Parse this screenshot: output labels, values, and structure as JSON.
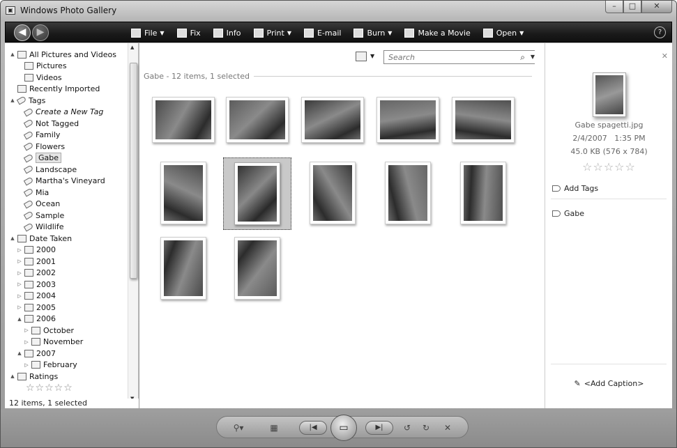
{
  "window": {
    "title": "Windows Photo Gallery"
  },
  "toolbar": {
    "items": [
      {
        "label": "File",
        "mnemonic": "F",
        "has_menu": true,
        "icon": "file-icon"
      },
      {
        "label": "Fix",
        "mnemonic": "x",
        "has_menu": false,
        "icon": "fix-icon"
      },
      {
        "label": "Info",
        "mnemonic": "I",
        "has_menu": false,
        "icon": "info-icon"
      },
      {
        "label": "Print",
        "mnemonic": "P",
        "has_menu": true,
        "icon": "print-icon"
      },
      {
        "label": "E-mail",
        "mnemonic": "E",
        "has_menu": false,
        "icon": "email-icon"
      },
      {
        "label": "Burn",
        "mnemonic": "u",
        "has_menu": true,
        "icon": "burn-icon"
      },
      {
        "label": "Make a Movie",
        "mnemonic": "k",
        "has_menu": false,
        "icon": "movie-icon"
      },
      {
        "label": "Open",
        "mnemonic": "O",
        "has_menu": true,
        "icon": "open-icon"
      }
    ],
    "help": "?"
  },
  "nav": {
    "items": [
      {
        "label": "All Pictures and Videos",
        "level": 0,
        "expander": "▲",
        "icon": "gallery-icon"
      },
      {
        "label": "Pictures",
        "level": 1,
        "expander": "",
        "icon": "pictures-icon"
      },
      {
        "label": "Videos",
        "level": 1,
        "expander": "",
        "icon": "videos-icon"
      },
      {
        "label": "Recently Imported",
        "level": 0,
        "expander": "",
        "icon": "recent-icon"
      },
      {
        "label": "Tags",
        "level": 0,
        "expander": "▲",
        "icon": "tag-icon"
      },
      {
        "label": "Create a New Tag",
        "level": 1,
        "expander": "",
        "icon": "new-tag-icon",
        "italic": true
      },
      {
        "label": "Not Tagged",
        "level": 1,
        "expander": "",
        "icon": "not-tagged-icon"
      },
      {
        "label": "Family",
        "level": 1,
        "expander": "",
        "icon": "tag-icon"
      },
      {
        "label": "Flowers",
        "level": 1,
        "expander": "",
        "icon": "tag-icon"
      },
      {
        "label": "Gabe",
        "level": 1,
        "expander": "",
        "icon": "tag-icon",
        "selected": true
      },
      {
        "label": "Landscape",
        "level": 1,
        "expander": "",
        "icon": "tag-icon"
      },
      {
        "label": "Martha's Vineyard",
        "level": 1,
        "expander": "",
        "icon": "tag-icon"
      },
      {
        "label": "Mia",
        "level": 1,
        "expander": "",
        "icon": "tag-icon"
      },
      {
        "label": "Ocean",
        "level": 1,
        "expander": "",
        "icon": "tag-icon"
      },
      {
        "label": "Sample",
        "level": 1,
        "expander": "",
        "icon": "tag-icon"
      },
      {
        "label": "Wildlife",
        "level": 1,
        "expander": "",
        "icon": "tag-icon"
      },
      {
        "label": "Date Taken",
        "level": 0,
        "expander": "▲",
        "icon": "calendar-icon"
      },
      {
        "label": "2000",
        "level": 1,
        "expander": "▷",
        "icon": "calendar-icon"
      },
      {
        "label": "2001",
        "level": 1,
        "expander": "▷",
        "icon": "calendar-icon"
      },
      {
        "label": "2002",
        "level": 1,
        "expander": "▷",
        "icon": "calendar-icon"
      },
      {
        "label": "2003",
        "level": 1,
        "expander": "▷",
        "icon": "calendar-icon"
      },
      {
        "label": "2004",
        "level": 1,
        "expander": "▷",
        "icon": "calendar-icon"
      },
      {
        "label": "2005",
        "level": 1,
        "expander": "▷",
        "icon": "calendar-icon"
      },
      {
        "label": "2006",
        "level": 1,
        "expander": "▲",
        "icon": "calendar-icon"
      },
      {
        "label": "October",
        "level": 2,
        "expander": "▷",
        "icon": "calendar-icon"
      },
      {
        "label": "November",
        "level": 2,
        "expander": "▷",
        "icon": "calendar-icon"
      },
      {
        "label": "2007",
        "level": 1,
        "expander": "▲",
        "icon": "calendar-icon"
      },
      {
        "label": "February",
        "level": 2,
        "expander": "▷",
        "icon": "calendar-icon"
      },
      {
        "label": "Ratings",
        "level": 0,
        "expander": "▲",
        "icon": "star-icon"
      },
      {
        "label": "☆☆☆☆☆",
        "level": 1,
        "expander": "",
        "icon": "",
        "stars": true
      }
    ]
  },
  "status": {
    "text": "12 items, 1 selected"
  },
  "main": {
    "search": {
      "placeholder": "Search"
    },
    "group_header": "Gabe - 12 items, 1 selected",
    "thumbnails": [
      {
        "name": "photo-01",
        "orientation": "landscape",
        "selected": false
      },
      {
        "name": "photo-02",
        "orientation": "landscape",
        "selected": false
      },
      {
        "name": "photo-03",
        "orientation": "landscape",
        "selected": false
      },
      {
        "name": "photo-04",
        "orientation": "landscape",
        "selected": false
      },
      {
        "name": "photo-05",
        "orientation": "landscape",
        "selected": false
      },
      {
        "name": "photo-06",
        "orientation": "portrait",
        "selected": false
      },
      {
        "name": "photo-07",
        "orientation": "portrait",
        "selected": true
      },
      {
        "name": "photo-08",
        "orientation": "portrait",
        "selected": false
      },
      {
        "name": "photo-09",
        "orientation": "portrait",
        "selected": false
      },
      {
        "name": "photo-10",
        "orientation": "portrait",
        "selected": false
      },
      {
        "name": "photo-11",
        "orientation": "portrait",
        "selected": false
      },
      {
        "name": "photo-12",
        "orientation": "portrait",
        "selected": false
      }
    ]
  },
  "info": {
    "filename": "Gabe spagetti.jpg",
    "date": "2/4/2007",
    "time": "1:35 PM",
    "size": "45.0 KB (576 x 784)",
    "rating_stars": "☆☆☆☆☆",
    "add_tags": "Add Tags",
    "tags": [
      "Gabe"
    ],
    "caption_placeholder": "<Add Caption>"
  },
  "playback": {
    "buttons": [
      "zoom-icon",
      "grid-icon",
      "previous-icon",
      "slideshow-icon",
      "next-icon",
      "rotate-left-icon",
      "rotate-right-icon",
      "delete-icon"
    ]
  },
  "colors": {
    "toolbar_bg": "#1a1a1a",
    "window_frame": "#a8a8a8",
    "selection": "#c9c9c9"
  }
}
